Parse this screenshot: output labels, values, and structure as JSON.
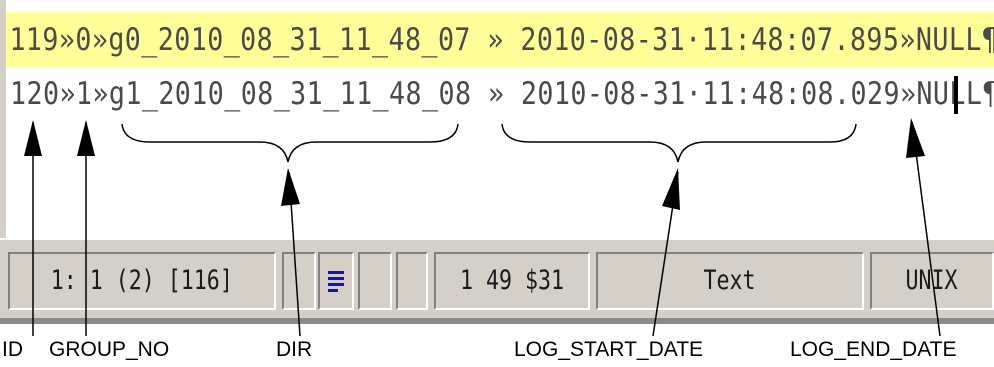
{
  "editor": {
    "lines": [
      "119»0»g0_2010_08_31_11_48_07 » 2010-08-31·11:48:07.895»NULL¶",
      "120»1»g1_2010_08_31_11_48_08 » 2010-08-31·11:48:08.029»NULL¶"
    ],
    "highlight_color": "#ffff99"
  },
  "statusbar": {
    "position": "1: 1  (2)  [116]",
    "cell2": "",
    "lines_icon": "lines-icon",
    "cell4": "",
    "cell5": "",
    "char_info": "1  49  $31",
    "mode": "Text",
    "eol": "UNIX"
  },
  "annotations": {
    "id": "ID",
    "group_no": "GROUP_NO",
    "dir": "DIR",
    "log_start_date": "LOG_START_DATE",
    "log_end_date": "LOG_END_DATE"
  }
}
